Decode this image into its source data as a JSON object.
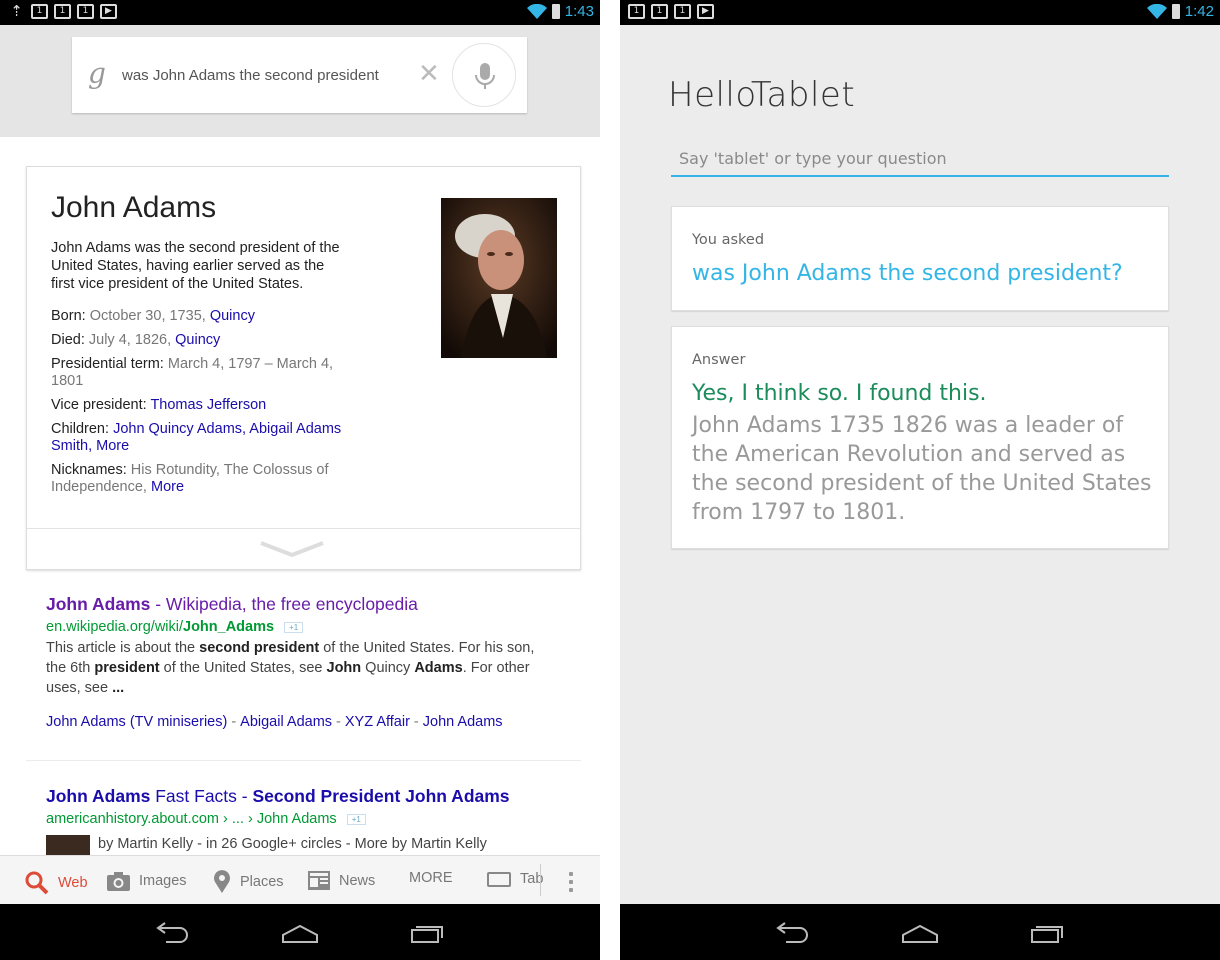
{
  "left_phone": {
    "status_bar": {
      "time": "1:43",
      "notification_icons": [
        "upload-icon",
        "notification-1",
        "notification-1",
        "notification-1",
        "store-icon"
      ]
    },
    "search": {
      "query": "was John Adams the second president",
      "logo_letter": "g"
    },
    "knowledge_card": {
      "title": "John Adams",
      "description": "John Adams was the second president of the United States, having earlier served as the first vice president of the United States.",
      "facts": {
        "born": {
          "label": "Born:",
          "value": "October 30, 1735,",
          "link": "Quincy"
        },
        "died": {
          "label": "Died:",
          "value": "July 4, 1826,",
          "link": "Quincy"
        },
        "term": {
          "label": "Presidential term:",
          "value": "March 4, 1797 – March 4, 1801"
        },
        "vp": {
          "label": "Vice president:",
          "link": "Thomas Jefferson"
        },
        "children": {
          "label": "Children:",
          "link1": "John Quincy Adams",
          "link2": "Abigail Adams Smith",
          "more": "More"
        },
        "nicknames": {
          "label": "Nicknames:",
          "value": "His Rotundity, The Colossus of Independence,",
          "more": "More"
        }
      }
    },
    "results": [
      {
        "title_bold": "John Adams",
        "title_rest": " - Wikipedia, the free encyclopedia",
        "url_plain": "en.wikipedia.org/wiki/",
        "url_bold": "John_Adams",
        "plus_one": "+1",
        "snippet": {
          "a": "This article is about the ",
          "b": "second president",
          "c": " of the United States. For his son, the 6th ",
          "d": "president",
          "e": " of the United States, see ",
          "f": "John",
          "g": " Quincy ",
          "h": "Adams",
          "i": ". For other uses, see ",
          "j": "..."
        },
        "sitelinks": [
          "John Adams (TV miniseries)",
          "Abigail Adams",
          "XYZ Affair",
          "John Adams"
        ],
        "sitelink_separator": "-"
      },
      {
        "title_part1": "John Adams",
        "title_part2": " Fast Facts - ",
        "title_part3": "Second President John Adams",
        "url": "americanhistory.about.com › ... › John Adams",
        "plus_one": "+1",
        "byline": "by Martin Kelly - in 26 Google+ circles - More by Martin Kelly"
      }
    ],
    "tabs": [
      {
        "label": "Web",
        "icon": "search-icon",
        "active": true
      },
      {
        "label": "Images",
        "icon": "camera-icon"
      },
      {
        "label": "Places",
        "icon": "map-pin-icon"
      },
      {
        "label": "News",
        "icon": "newspaper-icon"
      },
      {
        "label": "MORE"
      },
      {
        "label": "Tab",
        "icon": "tablet-icon"
      }
    ]
  },
  "right_phone": {
    "status_bar": {
      "time": "1:42",
      "notification_icons": [
        "notification-1",
        "notification-1",
        "notification-1",
        "store-icon"
      ]
    },
    "app_title": "HelloTablet",
    "input_placeholder": "Say 'tablet' or type your question",
    "asked_card": {
      "label": "You asked",
      "question": "was John Adams the second president?"
    },
    "answer_card": {
      "label": "Answer",
      "headline": "Yes, I think so. I found this.",
      "body": "John Adams 1735 1826 was a leader of the American Revolution and served as the second president of the United States from 1797 to 1801."
    }
  },
  "colors": {
    "holo_blue": "#33b5e5",
    "link_blue": "#1a0dab",
    "url_green": "#009933",
    "answer_green": "#1b8c5a",
    "active_tab_red": "#dd4b39"
  }
}
